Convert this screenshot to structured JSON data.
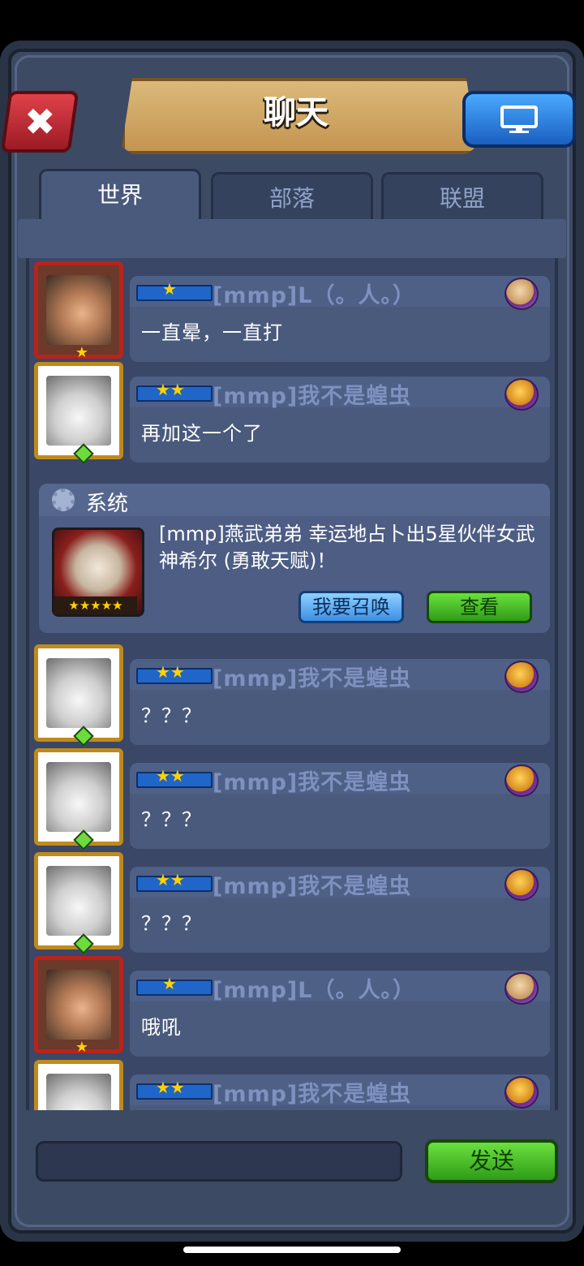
{
  "header": {
    "title": "聊天"
  },
  "tabs": [
    "世界",
    "部落",
    "联盟"
  ],
  "messages": [
    {
      "avatar": "girl",
      "stars": "★",
      "name": "[mmp]L（。人。）",
      "text": "一直晕，一直打",
      "badge": "light"
    },
    {
      "avatar": "dog",
      "stars": "★★",
      "name": "[mmp]我不是蝗虫",
      "text": "再加这一个了",
      "badge": "gold"
    },
    {
      "avatar": "dog",
      "stars": "★★",
      "name": "[mmp]我不是蝗虫",
      "text": "？？？",
      "badge": "gold"
    },
    {
      "avatar": "dog",
      "stars": "★★",
      "name": "[mmp]我不是蝗虫",
      "text": "？？？",
      "badge": "gold"
    },
    {
      "avatar": "dog",
      "stars": "★★",
      "name": "[mmp]我不是蝗虫",
      "text": "？？？",
      "badge": "gold"
    },
    {
      "avatar": "girl",
      "stars": "★",
      "name": "[mmp]L（。人。）",
      "text": "哦吼",
      "badge": "light"
    },
    {
      "avatar": "dog",
      "stars": "★★",
      "name": "[mmp]我不是蝗虫",
      "text": "",
      "badge": "gold"
    }
  ],
  "system": {
    "title": "系统",
    "text": "[mmp]燕武弟弟 幸运地占卜出5星伙伴女武神希尔 (勇敢天赋)！",
    "hero_stars": "★★★★★",
    "summon_label": "我要召唤",
    "view_label": "查看"
  },
  "input": {
    "value": ""
  },
  "send_label": "发送"
}
